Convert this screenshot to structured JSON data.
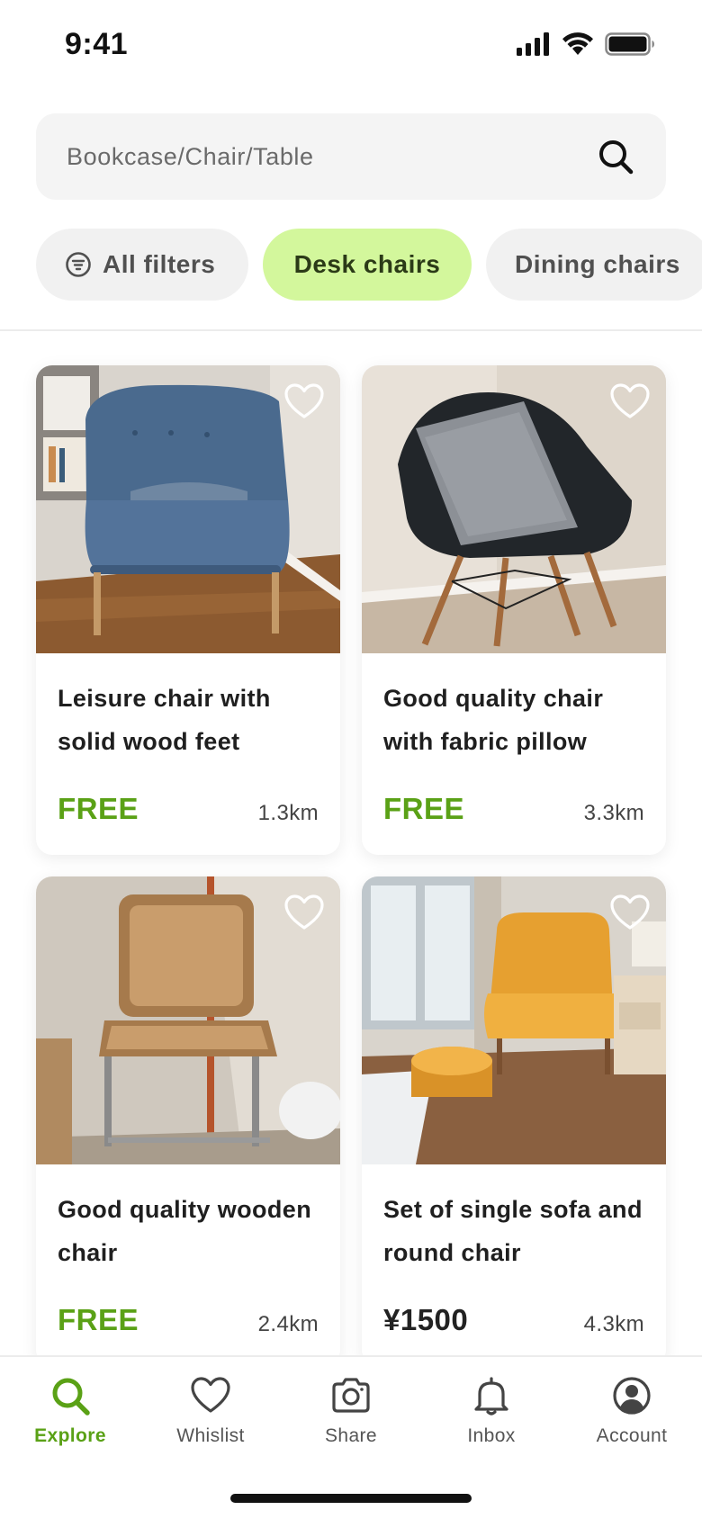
{
  "status_bar": {
    "time": "9:41"
  },
  "search": {
    "placeholder": "Bookcase/Chair/Table"
  },
  "chips": [
    {
      "label": "All filters"
    },
    {
      "label": "Desk chairs",
      "active": true
    },
    {
      "label": "Dining chairs"
    }
  ],
  "products": [
    {
      "title": "Leisure chair with solid wood feet",
      "price": "FREE",
      "distance": "1.3km"
    },
    {
      "title": "Good quality chair with fabric pillow",
      "price": "FREE",
      "distance": "3.3km"
    },
    {
      "title": "Good quality wooden chair",
      "price": "FREE",
      "distance": "2.4km"
    },
    {
      "title": "Set of single sofa and round chair",
      "price": "¥1500",
      "distance": "4.3km"
    }
  ],
  "nav": [
    {
      "label": "Explore",
      "icon": "search-icon",
      "active": true
    },
    {
      "label": "Whislist",
      "icon": "heart-icon"
    },
    {
      "label": "Share",
      "icon": "camera-icon"
    },
    {
      "label": "Inbox",
      "icon": "bell-icon"
    },
    {
      "label": "Account",
      "icon": "user-icon"
    }
  ],
  "colors": {
    "accent": "#5aa116",
    "chip_active": "#d3f79c",
    "search_bg": "#f4f4f4"
  }
}
